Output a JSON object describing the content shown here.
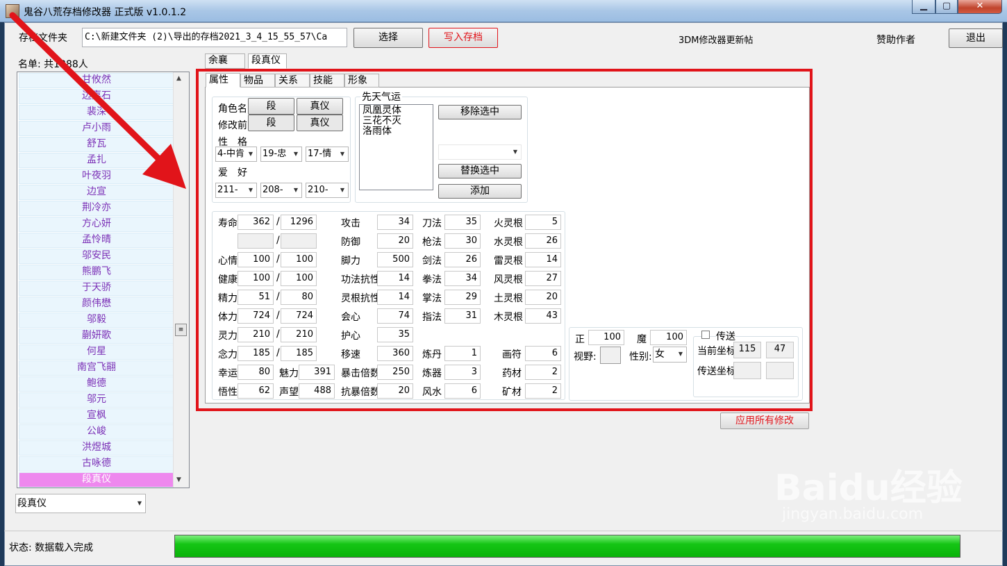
{
  "window": {
    "title": "鬼谷八荒存档修改器 正式版 v1.0.1.2",
    "min_icon": "minimize-icon",
    "max_icon": "maximize-icon",
    "close_icon": "close-icon"
  },
  "toolbar": {
    "folder_label": "存档文件夹",
    "folder_path": "C:\\新建文件夹 (2)\\导出的存档2021_3_4_15_55_57\\Ca",
    "select_label": "选择",
    "write_label": "写入存档",
    "update_link": "3DM修改器更新帖",
    "sponsor_link": "赞助作者",
    "exit_label": "退出"
  },
  "roster": {
    "header": "名单: 共1388人",
    "items": [
      "甘攸然",
      "边嘉石",
      "裴深",
      "卢小雨",
      "舒瓦",
      "孟扎",
      "叶夜羽",
      "边宣",
      "荆冷亦",
      "方心妍",
      "孟怜晴",
      "邬安民",
      "熊鹏飞",
      "于天骄",
      "颜伟懋",
      "邬毅",
      "蒯妍歌",
      "何星",
      "南宫飞翮",
      "鲍德",
      "邬元",
      "宣枫",
      "公峻",
      "洪煜城",
      "古咏德",
      "段真仪"
    ],
    "selected": "段真仪",
    "combo_value": "段真仪"
  },
  "char_tabs": [
    "余襄",
    "段真仪"
  ],
  "sub_tabs": [
    "属性",
    "物品",
    "关系",
    "技能",
    "形象"
  ],
  "identity": {
    "name_label": "角色名",
    "name_surname": "段",
    "name_given": "真仪",
    "prev_label": "修改前",
    "prev_surname": "段",
    "prev_given": "真仪",
    "trait_label": "性　格",
    "traits": [
      "4-中肯",
      "19-忠",
      "17-情"
    ],
    "hobby_label": "爱　好",
    "hobbies": [
      "211-",
      "208-",
      "210-"
    ]
  },
  "fortune": {
    "title": "先天气运",
    "list": [
      "凤凰灵体",
      "三花不灭",
      "洛雨体"
    ],
    "remove_label": "移除选中",
    "replace_label": "替换选中",
    "add_label": "添加"
  },
  "stats": {
    "col1": [
      {
        "label": "寿命",
        "cur": "362",
        "max": "1296"
      },
      {
        "label": "",
        "cur": "",
        "max": ""
      },
      {
        "label": "心情",
        "cur": "100",
        "max": "100"
      },
      {
        "label": "健康",
        "cur": "100",
        "max": "100"
      },
      {
        "label": "精力",
        "cur": "51",
        "max": "80"
      },
      {
        "label": "体力",
        "cur": "724",
        "max": "724"
      },
      {
        "label": "灵力",
        "cur": "210",
        "max": "210"
      },
      {
        "label": "念力",
        "cur": "185",
        "max": "185"
      }
    ],
    "slash": "/",
    "luck": {
      "label": "幸运",
      "value": "80"
    },
    "charm": {
      "label": "魅力",
      "value": "391"
    },
    "wisdom": {
      "label": "悟性",
      "value": "62"
    },
    "fame": {
      "label": "声望",
      "value": "488"
    },
    "col2": [
      {
        "label": "攻击",
        "value": "34"
      },
      {
        "label": "防御",
        "value": "20"
      },
      {
        "label": "脚力",
        "value": "500"
      },
      {
        "label": "功法抗性",
        "value": "14"
      },
      {
        "label": "灵根抗性",
        "value": "14"
      },
      {
        "label": "会心",
        "value": "74"
      },
      {
        "label": "护心",
        "value": "35"
      },
      {
        "label": "移速",
        "value": "360"
      },
      {
        "label": "暴击倍数",
        "value": "250"
      },
      {
        "label": "抗暴倍数",
        "value": "20"
      }
    ],
    "col3": [
      {
        "label": "刀法",
        "value": "35"
      },
      {
        "label": "枪法",
        "value": "30"
      },
      {
        "label": "剑法",
        "value": "26"
      },
      {
        "label": "拳法",
        "value": "34"
      },
      {
        "label": "掌法",
        "value": "29"
      },
      {
        "label": "指法",
        "value": "31"
      }
    ],
    "col3b": [
      {
        "label": "炼丹",
        "value": "1"
      },
      {
        "label": "炼器",
        "value": "3"
      },
      {
        "label": "风水",
        "value": "6"
      }
    ],
    "col4": [
      {
        "label": "火灵根",
        "value": "5"
      },
      {
        "label": "水灵根",
        "value": "26"
      },
      {
        "label": "雷灵根",
        "value": "14"
      },
      {
        "label": "风灵根",
        "value": "27"
      },
      {
        "label": "土灵根",
        "value": "20"
      },
      {
        "label": "木灵根",
        "value": "43"
      }
    ],
    "col4b": [
      {
        "label": "画符",
        "value": "6"
      },
      {
        "label": "药材",
        "value": "2"
      },
      {
        "label": "矿材",
        "value": "2"
      }
    ]
  },
  "misc": {
    "righteous_label": "正",
    "righteous": "100",
    "demon_label": "魔",
    "demon": "100",
    "vision_label": "视野:",
    "gender_label": "性别:",
    "gender": "女",
    "teleport_label": "传送",
    "cur_coord_label": "当前坐标",
    "cur_x": "115",
    "cur_y": "47",
    "tp_coord_label": "传送坐标"
  },
  "apply_label": "应用所有修改",
  "status": {
    "text": "状态: 数据载入完成",
    "progress": 1.0
  },
  "colors": {
    "accent_red": "#e1141a",
    "list_text": "#7b2fb6",
    "selected_bg": "#ee88ee",
    "progress": "#15c515"
  },
  "watermark": {
    "brand": "Baidu经验",
    "url": "jingyan.baidu.com"
  }
}
